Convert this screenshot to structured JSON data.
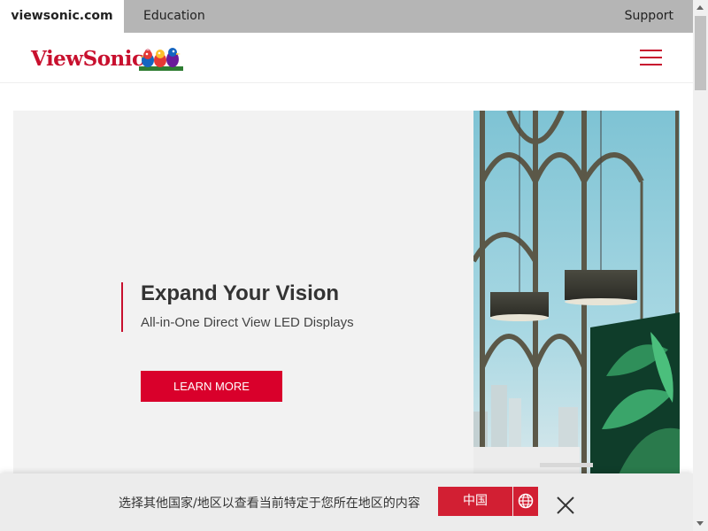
{
  "topbar": {
    "site_tab": "viewsonic.com",
    "education_tab": "Education",
    "support_link": "Support"
  },
  "header": {
    "logo_text": "ViewSonic",
    "logo_mark": "®"
  },
  "hero": {
    "title": "Expand Your Vision",
    "subtitle": "All-in-One Direct View LED Displays",
    "cta_label": "LEARN MORE"
  },
  "region_banner": {
    "message": "选择其他国家/地区以查看当前特定于您所在地区的内容",
    "region_button_label": "中国",
    "globe_icon": "globe-icon",
    "close_icon": "close-icon"
  },
  "colors": {
    "brand_red": "#c8102e",
    "cta_red": "#d9002b",
    "topbar_gray": "#b5b5b5"
  }
}
